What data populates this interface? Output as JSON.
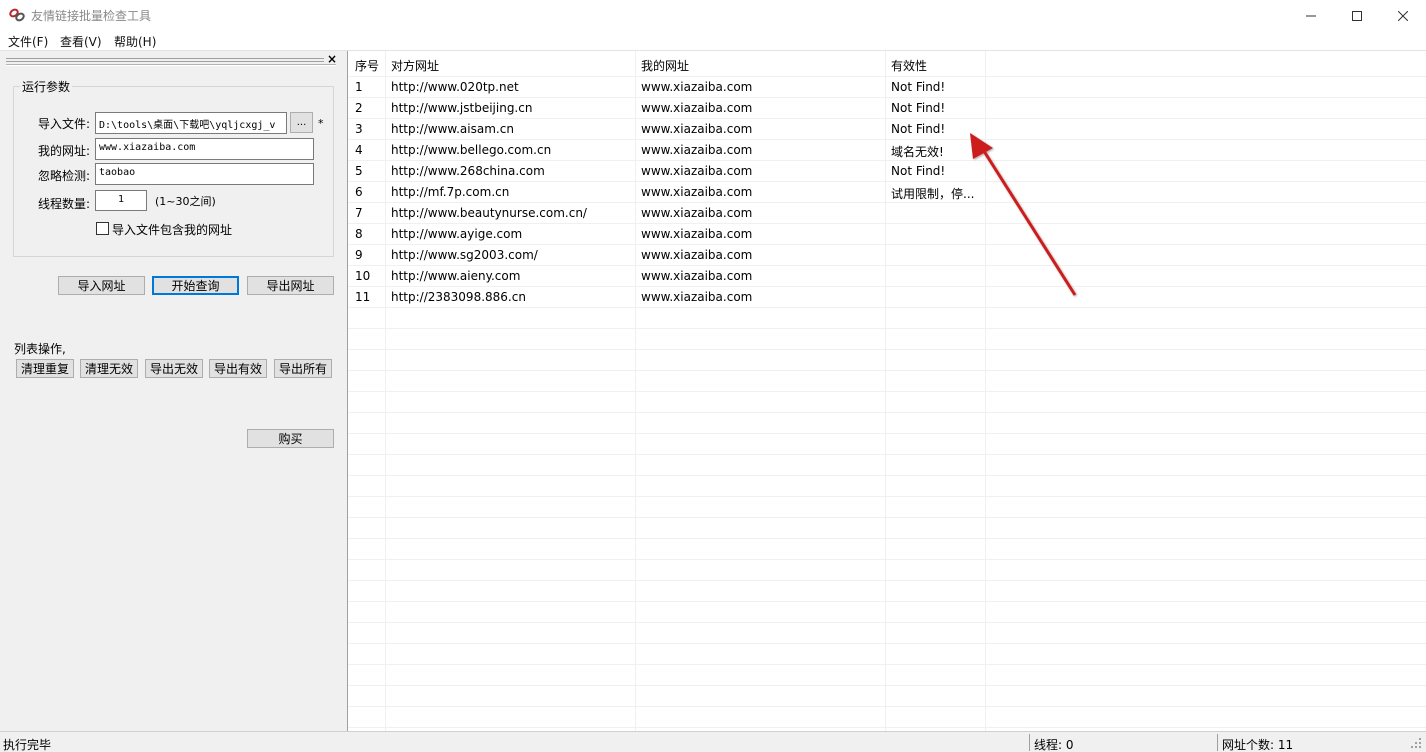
{
  "window": {
    "title": "友情链接批量检查工具"
  },
  "menu": [
    "文件(F)",
    "查看(V)",
    "帮助(H)"
  ],
  "params": {
    "group_title": "运行参数",
    "import_file_label": "导入文件:",
    "import_file_value": "D:\\tools\\桌面\\下载吧\\yqljcxgj_v",
    "browse_label": "...",
    "required_mark": "*",
    "my_url_label": "我的网址:",
    "my_url_value": "www.xiazaiba.com",
    "ignore_label": "忽略检测:",
    "ignore_value": "taobao",
    "threads_label": "线程数量:",
    "threads_value": "1",
    "threads_hint": "(1~30之间)",
    "include_label": "导入文件包含我的网址"
  },
  "actions": {
    "import": "导入网址",
    "start": "开始查询",
    "export": "导出网址"
  },
  "list_ops": {
    "label": "列表操作,",
    "buttons": [
      "清理重复",
      "清理无效",
      "导出无效",
      "导出有效",
      "导出所有"
    ]
  },
  "buy_label": "购买",
  "table": {
    "headers": [
      "序号",
      "对方网址",
      "我的网址",
      "有效性"
    ],
    "rows": [
      [
        "1",
        "http://www.020tp.net",
        "www.xiazaiba.com",
        "Not Find!"
      ],
      [
        "2",
        "http://www.jstbeijing.cn",
        "www.xiazaiba.com",
        "Not Find!"
      ],
      [
        "3",
        "http://www.aisam.cn",
        "www.xiazaiba.com",
        "Not Find!"
      ],
      [
        "4",
        "http://www.bellego.com.cn",
        "www.xiazaiba.com",
        "域名无效!"
      ],
      [
        "5",
        "http://www.268china.com",
        "www.xiazaiba.com",
        "Not Find!"
      ],
      [
        "6",
        "http://mf.7p.com.cn",
        "www.xiazaiba.com",
        "试用限制，停..."
      ],
      [
        "7",
        "http://www.beautynurse.com.cn/",
        "www.xiazaiba.com",
        ""
      ],
      [
        "8",
        "http://www.ayige.com",
        "www.xiazaiba.com",
        ""
      ],
      [
        "9",
        "http://www.sg2003.com/",
        "www.xiazaiba.com",
        ""
      ],
      [
        "10",
        "http://www.aieny.com",
        "www.xiazaiba.com",
        ""
      ],
      [
        "11",
        "http://2383098.886.cn",
        "www.xiazaiba.com",
        ""
      ]
    ]
  },
  "status": {
    "left": "执行完毕",
    "threads": "线程: 0",
    "count": "网址个数: 11"
  },
  "colors": {
    "arrow": "#cc1f1f",
    "focus": "#0078d7"
  }
}
